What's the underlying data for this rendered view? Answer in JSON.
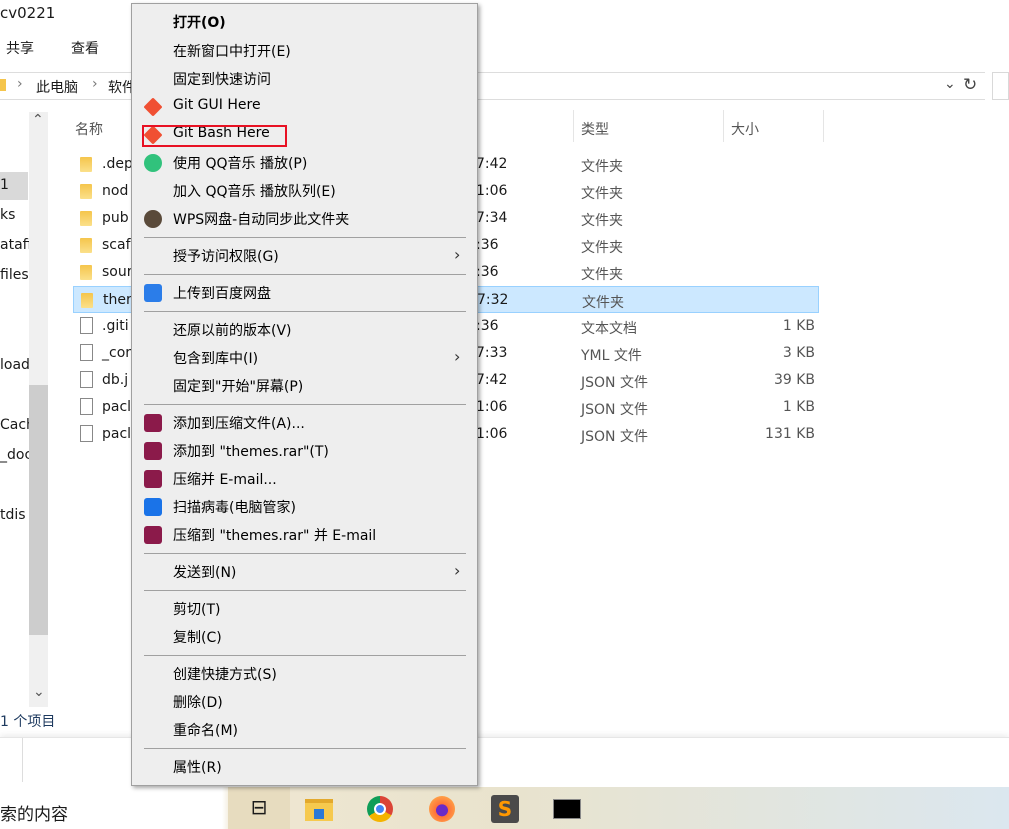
{
  "window": {
    "title": "cv0221"
  },
  "ribbon": {
    "tabs": [
      "共享",
      "查看"
    ]
  },
  "address": {
    "crumbs": [
      "此电脑",
      "软件"
    ]
  },
  "sidebar": {
    "items": [
      "1",
      "ks",
      "atafi",
      "files",
      "load",
      "Cach",
      "_doc",
      "tdis"
    ]
  },
  "columns": {
    "name": "名称",
    "type": "类型",
    "size": "大小"
  },
  "files": [
    {
      "name": ".dep",
      "time": "7:42",
      "type": "文件夹",
      "size": "",
      "kind": "folder"
    },
    {
      "name": "nod",
      "time": "1:06",
      "type": "文件夹",
      "size": "",
      "kind": "folder"
    },
    {
      "name": "pub",
      "time": "7:34",
      "type": "文件夹",
      "size": "",
      "kind": "folder"
    },
    {
      "name": "scaf",
      "time": ":36",
      "type": "文件夹",
      "size": "",
      "kind": "folder"
    },
    {
      "name": "sour",
      "time": ":36",
      "type": "文件夹",
      "size": "",
      "kind": "folder"
    },
    {
      "name": "ther",
      "time": "7:32",
      "type": "文件夹",
      "size": "",
      "kind": "folder",
      "selected": true
    },
    {
      "name": ".giti",
      "time": ":36",
      "type": "文本文档",
      "size": "1 KB",
      "kind": "text"
    },
    {
      "name": "_cor",
      "time": "7:33",
      "type": "YML 文件",
      "size": "3 KB",
      "kind": "file"
    },
    {
      "name": "db.j",
      "time": "7:42",
      "type": "JSON 文件",
      "size": "39 KB",
      "kind": "file"
    },
    {
      "name": "pacl",
      "time": "1:06",
      "type": "JSON 文件",
      "size": "1 KB",
      "kind": "file"
    },
    {
      "name": "pacl",
      "time": "1:06",
      "type": "JSON 文件",
      "size": "131 KB",
      "kind": "file"
    }
  ],
  "status": {
    "count": "1 个项目"
  },
  "taskbar": {
    "search_text": "索的内容",
    "apps": [
      "task-view-icon",
      "file-explorer-icon",
      "chrome-icon",
      "firefox-icon",
      "sublime-text-icon",
      "cmd-icon"
    ]
  },
  "context_menu": {
    "items": [
      {
        "label": "打开(O)",
        "bold": true
      },
      {
        "label": "在新窗口中打开(E)"
      },
      {
        "label": "固定到快速访问"
      },
      {
        "label": "Git GUI Here",
        "icon": "git-gui-icon"
      },
      {
        "label": "Git Bash Here",
        "icon": "git-bash-icon",
        "highlighted": true
      },
      {
        "label": "使用 QQ音乐 播放(P)",
        "icon": "qq-music-icon"
      },
      {
        "label": "加入 QQ音乐 播放队列(E)"
      },
      {
        "label": "WPS网盘-自动同步此文件夹",
        "icon": "wps-icon"
      },
      {
        "label": "授予访问权限(G)",
        "submenu": true
      },
      {
        "label": "上传到百度网盘",
        "icon": "baidu-netdisk-icon"
      },
      {
        "label": "还原以前的版本(V)"
      },
      {
        "label": "包含到库中(I)",
        "submenu": true
      },
      {
        "label": "固定到\"开始\"屏幕(P)"
      },
      {
        "label": "添加到压缩文件(A)...",
        "icon": "winrar-icon"
      },
      {
        "label": "添加到 \"themes.rar\"(T)",
        "icon": "winrar-icon"
      },
      {
        "label": "压缩并 E-mail...",
        "icon": "winrar-icon"
      },
      {
        "label": "扫描病毒(电脑管家)",
        "icon": "pc-manager-icon"
      },
      {
        "label": "压缩到 \"themes.rar\" 并 E-mail",
        "icon": "winrar-icon"
      },
      {
        "label": "发送到(N)",
        "submenu": true
      },
      {
        "label": "剪切(T)"
      },
      {
        "label": "复制(C)"
      },
      {
        "label": "创建快捷方式(S)"
      },
      {
        "label": "删除(D)"
      },
      {
        "label": "重命名(M)"
      },
      {
        "label": "属性(R)"
      }
    ]
  },
  "colors": {
    "selection": "#cce8ff",
    "menu_bg": "#eeeeee",
    "highlight_box": "#e81123"
  }
}
